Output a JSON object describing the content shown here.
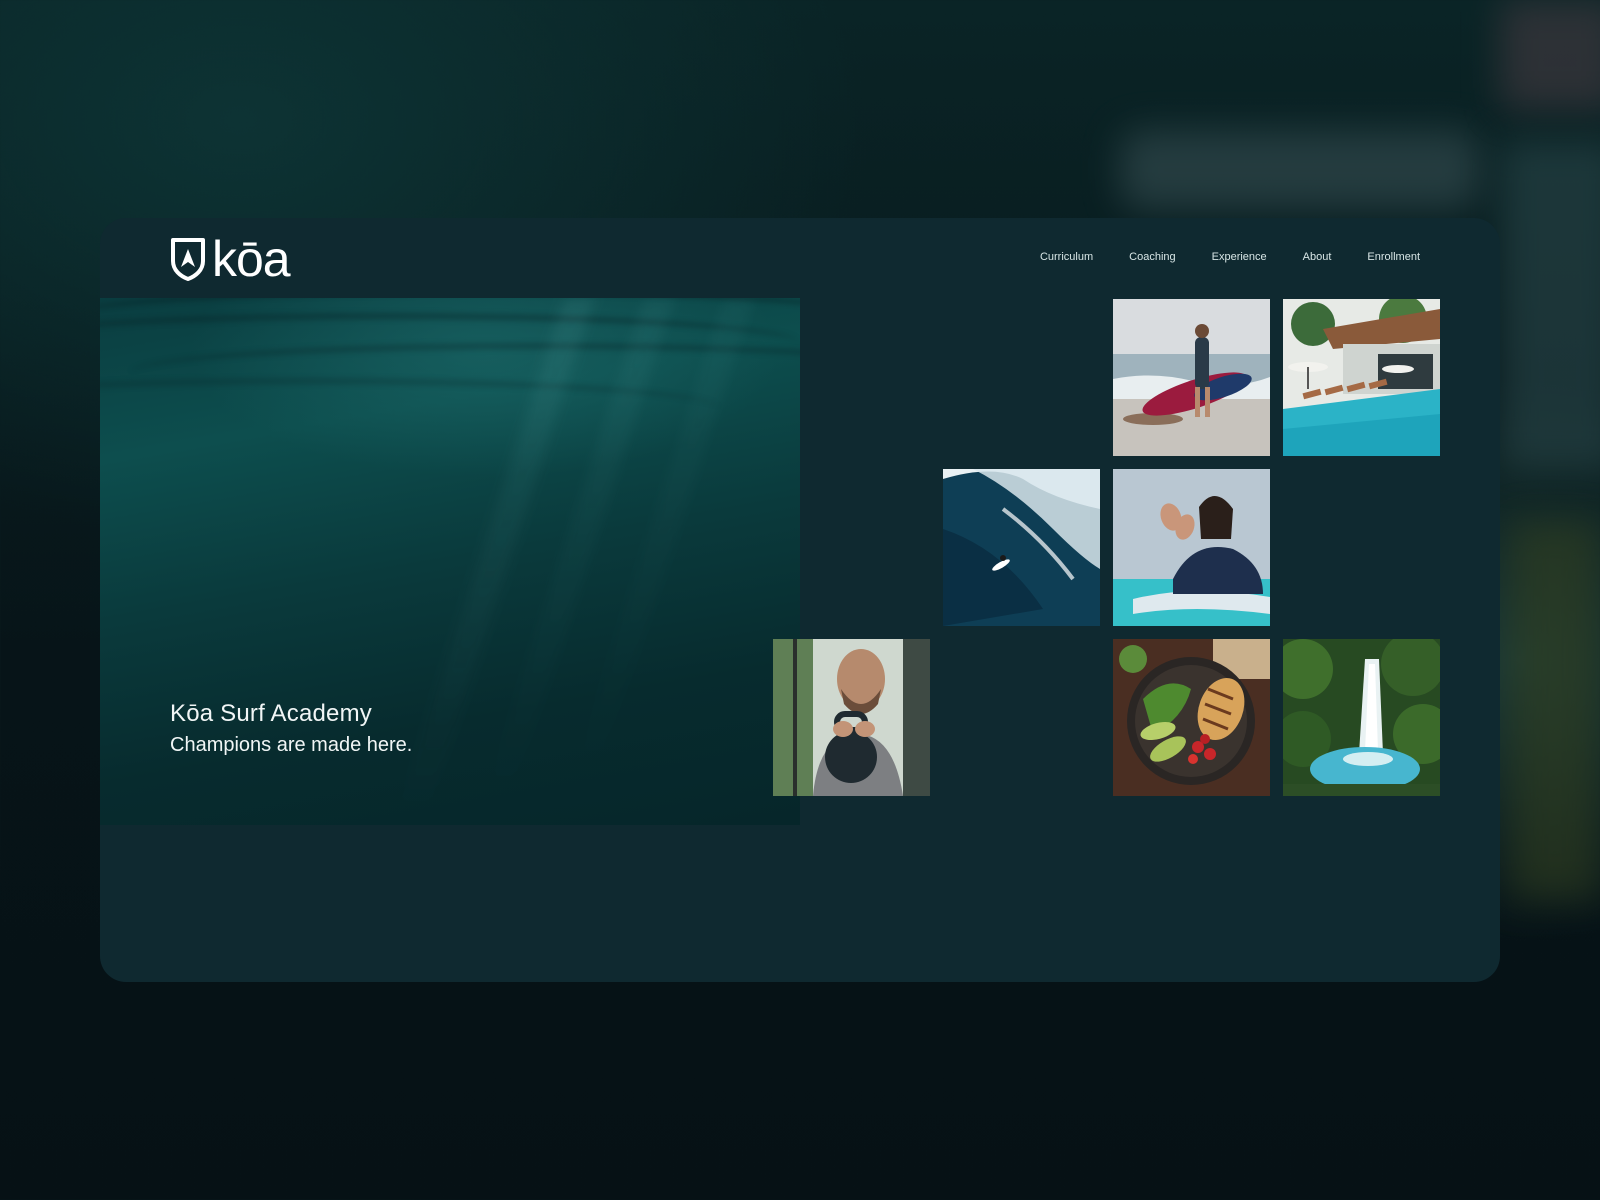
{
  "brand": {
    "logo_text": "kōa",
    "logo_icon": "shield-icon"
  },
  "nav": {
    "items": [
      {
        "label": "Curriculum"
      },
      {
        "label": "Coaching"
      },
      {
        "label": "Experience"
      },
      {
        "label": "About"
      },
      {
        "label": "Enrollment"
      }
    ]
  },
  "hero": {
    "title": "Kōa Surf Academy",
    "subtitle": "Champions are made here."
  },
  "gallery": {
    "images": [
      "surfer-with-board-photo",
      "villa-pool-photo",
      "big-wave-surfing-photo",
      "coach-clapping-photo",
      "kettlebell-workout-photo",
      "healthy-bowl-photo",
      "waterfall-photo"
    ]
  },
  "colors": {
    "window_bg": "#0f2930",
    "page_bg": "#071418",
    "accent": "#0d4e4e",
    "text": "#ffffff"
  }
}
